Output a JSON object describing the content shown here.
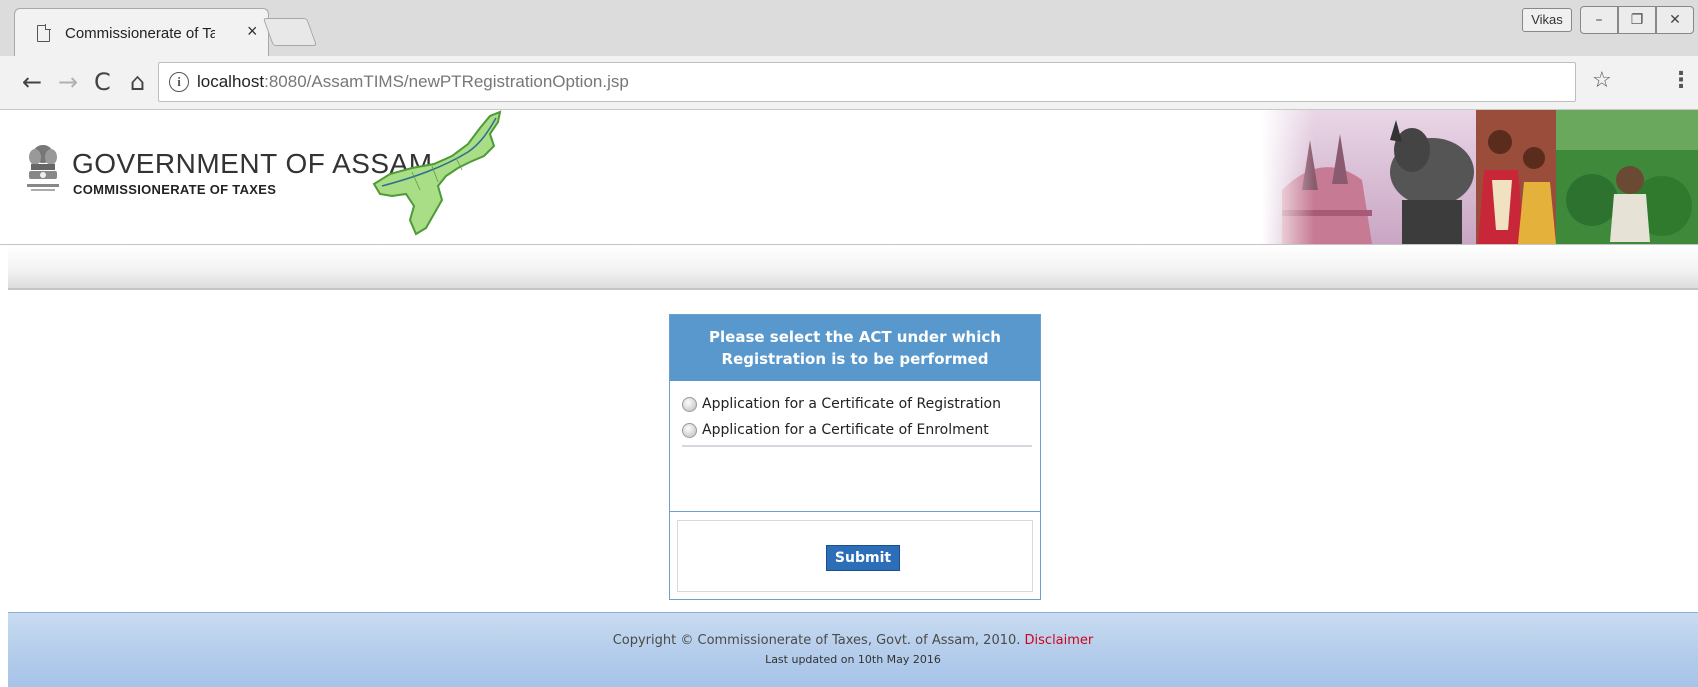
{
  "browser": {
    "tab_title": "Commissionerate of Taxe",
    "tab_close": "×",
    "user_badge": "Vikas",
    "window_buttons": [
      "–",
      "❐",
      "✕"
    ],
    "nav": {
      "back": "←",
      "forward": "→",
      "reload": "C",
      "home": "⌂"
    },
    "url_host": "localhost",
    "url_path": ":8080/AssamTIMS/newPTRegistrationOption.jsp",
    "bookmark": "☆",
    "menu": "⋮"
  },
  "header": {
    "title": "GOVERNMENT OF ASSAM",
    "subtitle": "COMMISSIONERATE OF TAXES",
    "emblem_icon": "state-emblem-icon",
    "map_icon": "assam-map-icon"
  },
  "form": {
    "heading_line1": "Please select the ACT under which",
    "heading_line2": "Registration is to be performed",
    "options": [
      {
        "label": "Application for a Certificate of Registration",
        "selected": false
      },
      {
        "label": "Application for a Certificate of Enrolment",
        "selected": false
      }
    ],
    "submit_label": "Submit"
  },
  "footer": {
    "copyright": "Copyright © Commissionerate of Taxes, Govt. of Assam, 2010.",
    "disclaimer": "Disclaimer",
    "last_updated": "Last updated on 10th May 2016"
  },
  "colors": {
    "panel_header": "#5998cd",
    "submit_button": "#2c6fb8",
    "disclaimer_link": "#d0021b",
    "footer_band": "#b7cfec"
  }
}
